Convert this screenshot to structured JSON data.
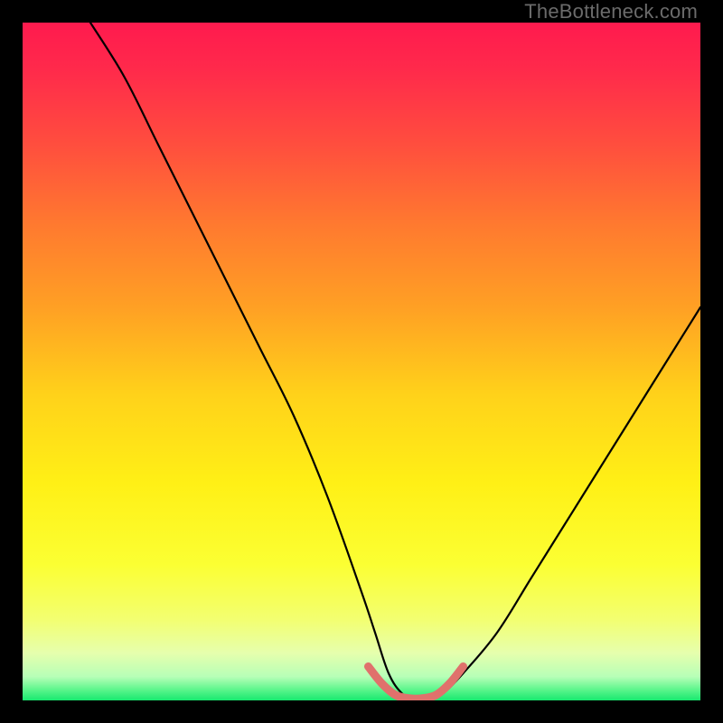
{
  "watermark": {
    "text": "TheBottleneck.com"
  },
  "colors": {
    "page_bg": "#000000",
    "curve_stroke": "#000000",
    "tolerance_stroke": "#e0716c",
    "gradient_stops": [
      {
        "offset": 0.0,
        "color": "#ff1a4e"
      },
      {
        "offset": 0.07,
        "color": "#ff2a4b"
      },
      {
        "offset": 0.18,
        "color": "#ff4e3e"
      },
      {
        "offset": 0.3,
        "color": "#ff7a2f"
      },
      {
        "offset": 0.42,
        "color": "#ffa024"
      },
      {
        "offset": 0.55,
        "color": "#ffd21a"
      },
      {
        "offset": 0.68,
        "color": "#fff016"
      },
      {
        "offset": 0.8,
        "color": "#fbff33"
      },
      {
        "offset": 0.88,
        "color": "#f3ff70"
      },
      {
        "offset": 0.93,
        "color": "#e6ffad"
      },
      {
        "offset": 0.965,
        "color": "#b7ffb7"
      },
      {
        "offset": 0.985,
        "color": "#58f58a"
      },
      {
        "offset": 1.0,
        "color": "#18e86f"
      }
    ]
  },
  "chart_data": {
    "type": "line",
    "title": "",
    "xlabel": "",
    "ylabel": "",
    "xlim": [
      0,
      100
    ],
    "ylim": [
      0,
      100
    ],
    "note": "V-shaped bottleneck curve. y is % bottleneck (0 = balanced at valley). x is relative component strength. Values estimated from pixel positions; axes have no numeric ticks in the source image.",
    "series": [
      {
        "name": "bottleneck-curve",
        "x": [
          10,
          15,
          20,
          25,
          30,
          35,
          40,
          45,
          50,
          52,
          54,
          56,
          58,
          60,
          62,
          65,
          70,
          75,
          80,
          85,
          90,
          95,
          100
        ],
        "y": [
          100,
          92,
          82,
          72,
          62,
          52,
          42,
          30,
          16,
          10,
          4,
          1,
          0,
          0,
          1,
          4,
          10,
          18,
          26,
          34,
          42,
          50,
          58
        ]
      },
      {
        "name": "tolerance-band",
        "x": [
          51,
          53,
          55,
          57,
          59,
          61,
          63,
          65
        ],
        "y": [
          5,
          2.5,
          0.8,
          0.3,
          0.3,
          0.8,
          2.5,
          5
        ]
      }
    ]
  }
}
